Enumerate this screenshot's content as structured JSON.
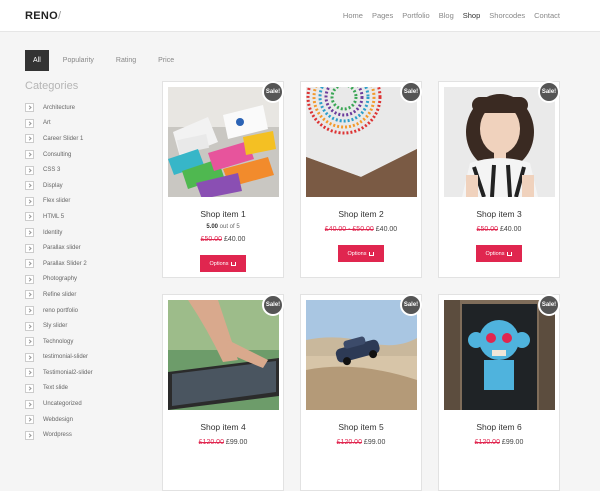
{
  "header": {
    "logo": "RENO",
    "logo_slash": "/",
    "nav": [
      "Home",
      "Pages",
      "Portfolio",
      "Blog",
      "Shop",
      "Shorcodes",
      "Contact"
    ],
    "active_nav": "Shop"
  },
  "filters": [
    "All",
    "Popularity",
    "Rating",
    "Price"
  ],
  "sidebar": {
    "title": "Categories",
    "items": [
      "Architecture",
      "Art",
      "Career Slider 1",
      "Consulting",
      "CSS 3",
      "Display",
      "Flex slider",
      "HTML 5",
      "Identity",
      "Parallax slider",
      "Parallax Slider 2",
      "Photography",
      "Refine slider",
      "reno portfolio",
      "Sly slider",
      "Technology",
      "testimonial-slider",
      "Testimonial2-slider",
      "Text slide",
      "Uncategorized",
      "Webdesign",
      "Wordpress"
    ]
  },
  "products": [
    {
      "title": "Shop item 1",
      "sale": "Sale!",
      "rating_value": "5.00",
      "rating_suffix": "out of 5",
      "old_price": "£50.00",
      "new_price": "£40.00",
      "button": "Options"
    },
    {
      "title": "Shop item 2",
      "sale": "Sale!",
      "old_price": "£40.00 - £50.00",
      "new_price": "£40.00",
      "button": "Options"
    },
    {
      "title": "Shop item 3",
      "sale": "Sale!",
      "old_price": "£50.00",
      "new_price": "£40.00",
      "button": "Options"
    },
    {
      "title": "Shop item 4",
      "sale": "Sale!",
      "old_price": "£120.00",
      "new_price": "£99.00"
    },
    {
      "title": "Shop item 5",
      "sale": "Sale!",
      "old_price": "£120.00",
      "new_price": "£99.00"
    },
    {
      "title": "Shop item 6",
      "sale": "Sale!",
      "old_price": "£120.00",
      "new_price": "£99.00"
    }
  ],
  "colors": {
    "accent": "#e0264f",
    "badge": "#555555"
  },
  "icons": {
    "cart": "cart-icon",
    "arrow": "chevron-right-icon"
  }
}
